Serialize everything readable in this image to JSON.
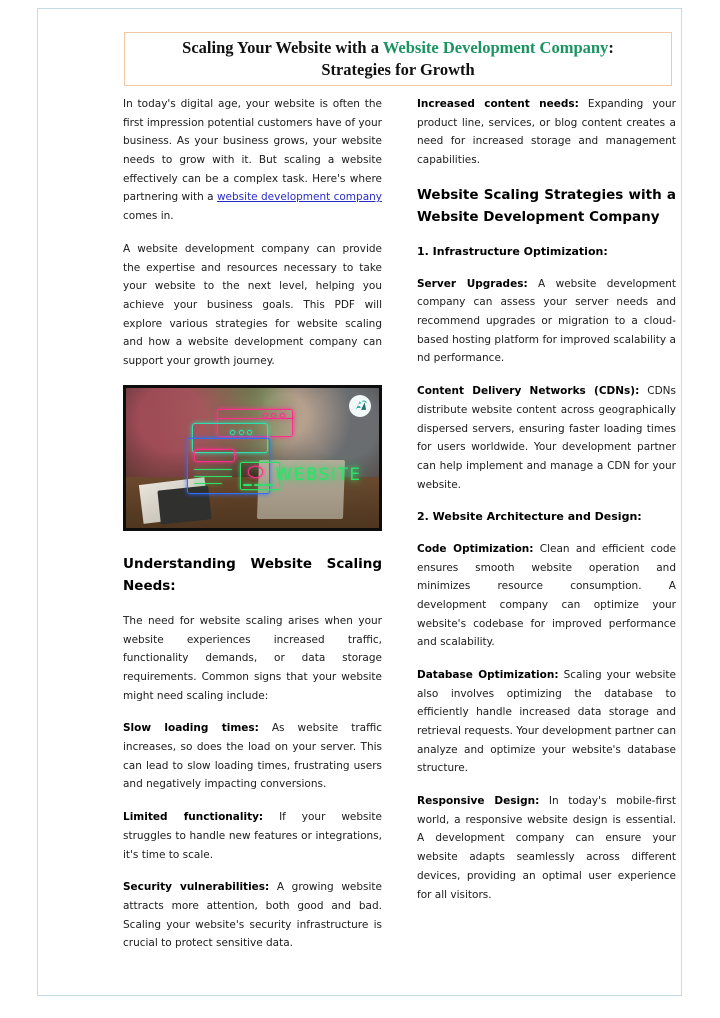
{
  "document": {
    "title": {
      "line1_prefix": "Scaling Your Website with a ",
      "line1_accent": "Website Development Company",
      "line1_suffix": ":",
      "line2": "Strategies for Growth",
      "accent_color": "#1a9460",
      "border_color": "#f0c9a4"
    },
    "page_border_color": "#c3dbe2",
    "link_color": "#2b2bc8"
  },
  "left_column": {
    "intro_para_1_before_link": "In today's digital age, your website is often the first impression potential customers have of your business. As your business grows, your website needs to grow with it. But scaling a website effectively can be a complex task. Here's where partnering with a ",
    "intro_link_text": "website development company",
    "intro_para_1_after_link": " comes in.",
    "intro_para_2": "A website development company can provide the expertise and resources necessary to take your website to the next level, helping you achieve your business goals. This PDF will explore various strategies for website scaling and how a website development company can support your growth journey.",
    "figure": {
      "neon_word": "WEBSITE",
      "logo_label": "AI",
      "alt": "Team of people at a laptop with neon website interface graphics overlay"
    },
    "heading": "Understanding Website Scaling Needs:",
    "para_need": "The need for website scaling arises when your website experiences increased traffic, functionality demands, or data storage requirements. Common signs that your website might need scaling include:",
    "items": [
      {
        "lead": "Slow loading times:",
        "text": " As website traffic increases, so does the load on your server. This can lead to slow loading times, frustrating users and negatively impacting conversions."
      },
      {
        "lead": "Limited functionality:",
        "text": " If your website struggles to handle new features or integrations, it's time to scale."
      },
      {
        "lead": "Security vulnerabilities:",
        "text": " A growing website attracts more attention, both good and bad. Scaling your website's security infrastructure is crucial to protect sensitive data."
      }
    ]
  },
  "right_column": {
    "item_content_needs": {
      "lead": "Increased content needs:",
      "text": " Expanding your product line, services, or blog content creates a need for increased storage and management capabilities."
    },
    "heading": "Website Scaling Strategies with a Website Development Company",
    "subsection_1": "1. Infrastructure Optimization:",
    "items_1": [
      {
        "lead": "Server Upgrades:",
        "text": " A website development company can assess your server needs and recommend upgrades or migration to a cloud-based hosting platform for improved scalability a nd performance."
      },
      {
        "lead": "Content Delivery Networks (CDNs):",
        "text": " CDNs distribute website content across geographically dispersed servers, ensuring faster loading times for users worldwide. Your development partner can help implement and manage a CDN for your website."
      }
    ],
    "subsection_2": "2. Website Architecture and Design:",
    "items_2": [
      {
        "lead": "Code Optimization:",
        "text": " Clean and efficient code ensures smooth website operation and minimizes resource consumption. A development company can optimize your website's codebase for improved performance and scalability."
      },
      {
        "lead": "Database Optimization:",
        "text": " Scaling your website also involves optimizing the database to efficiently handle increased data storage and retrieval requests. Your development partner can analyze and optimize your website's database structure."
      },
      {
        "lead": "Responsive Design:",
        "text": " In today's mobile-first world, a responsive website design is essential. A development company can ensure your website adapts seamlessly across different devices, providing an optimal user experience for all visitors."
      }
    ]
  }
}
